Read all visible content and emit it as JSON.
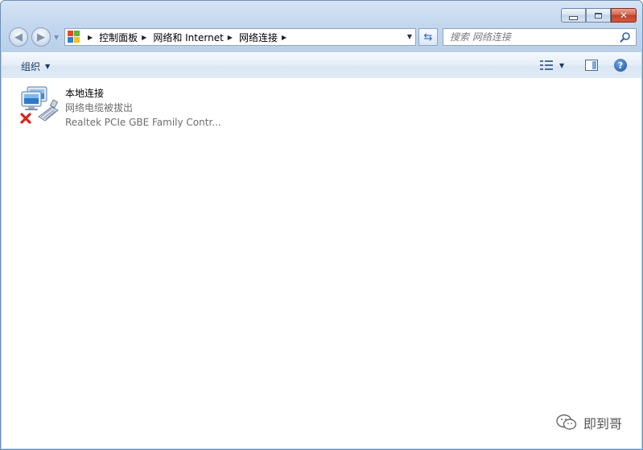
{
  "window": {
    "minimize_label": "",
    "maximize_label": "",
    "close_label": "✕"
  },
  "navbar": {
    "back_icon": "back-arrow-icon",
    "forward_icon": "forward-arrow-icon",
    "breadcrumbs": [
      "控制面板",
      "网络和 Internet",
      "网络连接"
    ],
    "refresh_icon": "refresh-icon",
    "search": {
      "placeholder": "搜索 网络连接",
      "value": ""
    }
  },
  "toolbar": {
    "organize_label": "组织",
    "views_icon": "views-icon",
    "preview_pane_icon": "preview-pane-icon",
    "help_icon": "help-icon",
    "help_label": "?"
  },
  "connections": [
    {
      "name": "本地连接",
      "status": "网络电缆被拔出",
      "adapter": "Realtek PCIe GBE Family Contr..."
    }
  ],
  "watermark": {
    "text": "即到哥"
  },
  "colors": {
    "window_border": "#6b8fb8",
    "toolbar_text": "#1e395b",
    "status_text": "#6d6d6d",
    "close_red": "#c24129"
  }
}
